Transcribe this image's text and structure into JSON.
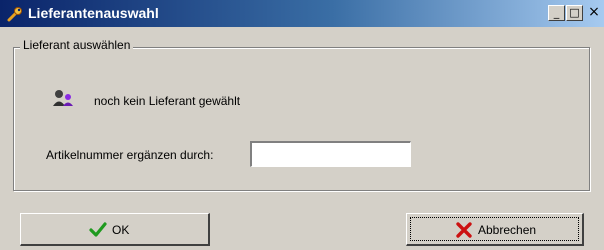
{
  "window": {
    "title": "Lieferantenauswahl",
    "controls": {
      "minimize": "_",
      "maximize": "□",
      "close": "×"
    }
  },
  "group": {
    "label": "Lieferant auswählen",
    "supplier_status": "noch kein Lieferant gewählt",
    "artikel_label": "Artikelnummer ergänzen durch:",
    "artikel_value": ""
  },
  "buttons": {
    "ok_label": "OK",
    "cancel_label": "Abbrechen"
  },
  "colors": {
    "title_gradient_start": "#0a246a",
    "title_gradient_end": "#a6caf0",
    "window_bg": "#d4d0c8",
    "ok_check": "#1f9a1f",
    "cancel_x": "#cc1111"
  },
  "icons": {
    "title": "wrench-icon",
    "supplier": "supplier-people-icon",
    "ok": "checkmark-icon",
    "cancel": "x-mark-icon"
  }
}
